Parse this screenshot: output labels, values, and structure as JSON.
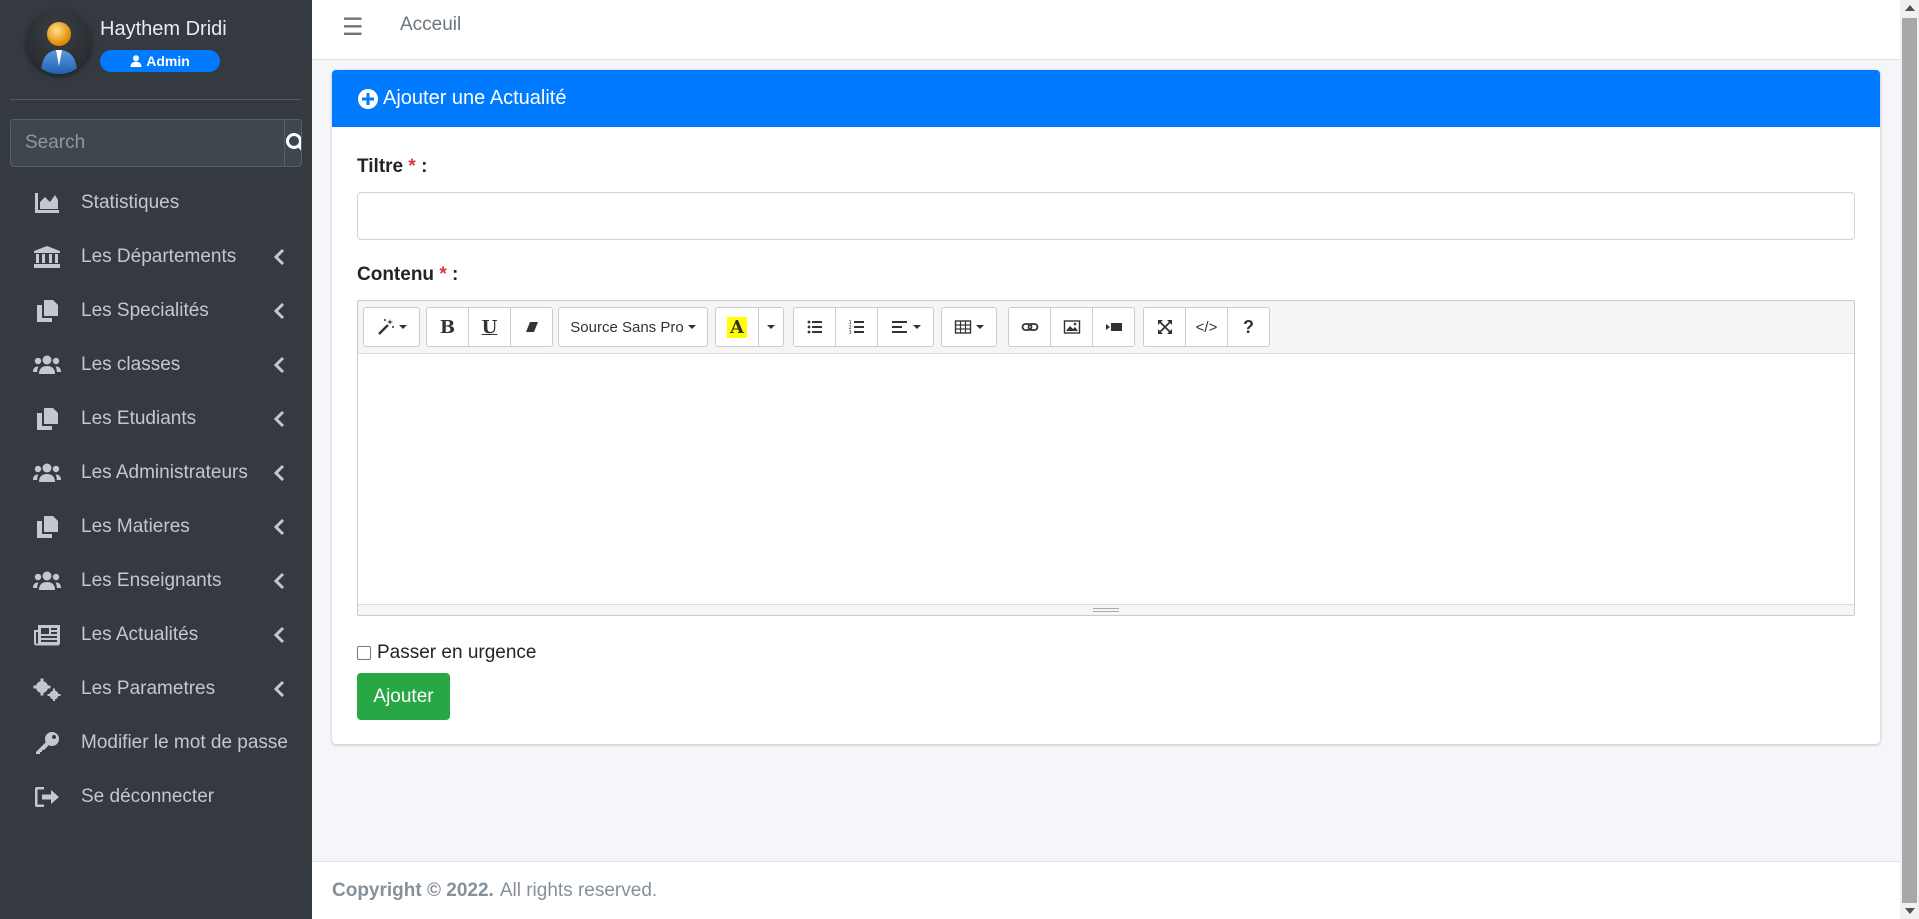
{
  "user": {
    "name": "Haythem Dridi",
    "role": "Admin"
  },
  "search": {
    "placeholder": "Search"
  },
  "sidebar": {
    "items": [
      {
        "label": "Statistiques",
        "icon": "chart-area-icon",
        "has_submenu": false
      },
      {
        "label": "Les Départements",
        "icon": "university-icon",
        "has_submenu": true
      },
      {
        "label": "Les Specialités",
        "icon": "copy-icon",
        "has_submenu": true
      },
      {
        "label": "Les classes",
        "icon": "users-icon",
        "has_submenu": true
      },
      {
        "label": "Les Etudiants",
        "icon": "copy-icon",
        "has_submenu": true
      },
      {
        "label": "Les Administrateurs",
        "icon": "users-icon",
        "has_submenu": true
      },
      {
        "label": "Les Matieres",
        "icon": "copy-icon",
        "has_submenu": true
      },
      {
        "label": "Les Enseignants",
        "icon": "users-icon",
        "has_submenu": true
      },
      {
        "label": "Les Actualités",
        "icon": "newspaper-icon",
        "has_submenu": true
      },
      {
        "label": "Les Parametres",
        "icon": "cogs-icon",
        "has_submenu": true
      },
      {
        "label": "Modifier le mot de passe",
        "icon": "key-icon",
        "has_submenu": false
      },
      {
        "label": "Se déconnecter",
        "icon": "sign-out-icon",
        "has_submenu": false
      }
    ]
  },
  "topbar": {
    "link": "Acceuil"
  },
  "card": {
    "title": "Ajouter une Actualité",
    "title_label": "Tiltre",
    "content_label": "Contenu",
    "required_mark": "*",
    "label_suffix": " :",
    "urgent_label": "Passer en urgence",
    "submit_label": "Ajouter"
  },
  "editor": {
    "font_name": "Source Sans Pro",
    "bold": "B",
    "underline": "U",
    "color_letter": "A",
    "code": "</>",
    "help": "?"
  },
  "footer": {
    "copyright": "Copyright © 2022.",
    "rights": "All rights reserved."
  },
  "colors": {
    "primary": "#007bff",
    "success": "#28a745",
    "sidebar": "#343a40",
    "required": "#dc3545",
    "highlight": "#ffff00"
  }
}
